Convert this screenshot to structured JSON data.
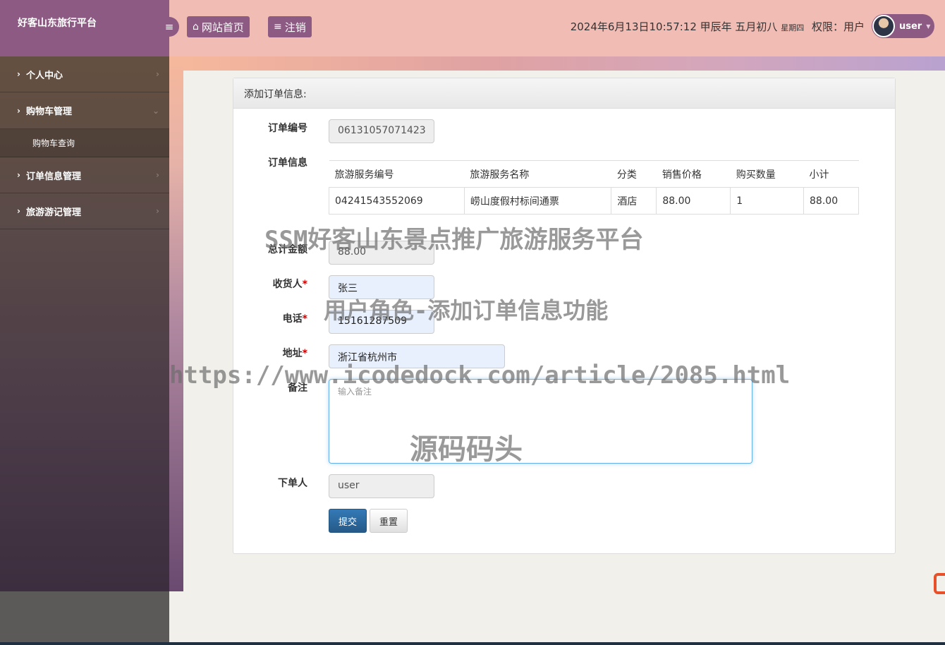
{
  "app": {
    "title": "好客山东旅行平台"
  },
  "header": {
    "home_label": "网站首页",
    "logout_label": "注销",
    "datetime": "2024年6月13日10:57:12 甲辰年 五月初八",
    "weekday": "星期四",
    "permission": "权限：用户",
    "username": "user"
  },
  "sidebar": {
    "items": [
      {
        "label": "个人中心"
      },
      {
        "label": "购物车管理"
      },
      {
        "label": "订单信息管理"
      },
      {
        "label": "旅游游记管理"
      }
    ],
    "sub_item": "购物车查询"
  },
  "form": {
    "heading": "添加订单信息:",
    "order_no_label": "订单编号",
    "order_no": "06131057071423",
    "order_info_label": "订单信息",
    "table": {
      "headers": [
        "旅游服务编号",
        "旅游服务名称",
        "分类",
        "销售价格",
        "购买数量",
        "小计"
      ],
      "rows": [
        [
          "04241543552069",
          "崂山度假村标间通票",
          "酒店",
          "88.00",
          "1",
          "88.00"
        ]
      ]
    },
    "total_label": "总计金额",
    "total": "88.00",
    "receiver_label": "收货人",
    "receiver": "张三",
    "phone_label": "电话",
    "phone": "15161287509",
    "address_label": "地址",
    "address": "浙江省杭州市",
    "remark_label": "备注",
    "remark_placeholder": "输入备注",
    "orderer_label": "下单人",
    "orderer": "user",
    "submit_label": "提交",
    "reset_label": "重置"
  },
  "watermarks": {
    "title": "SSM好客山东景点推广旅游服务平台",
    "subtitle": "用户角色-添加订单信息功能",
    "url": "https://www.icodedock.com/article/2085.html",
    "brand": "源码码头"
  }
}
